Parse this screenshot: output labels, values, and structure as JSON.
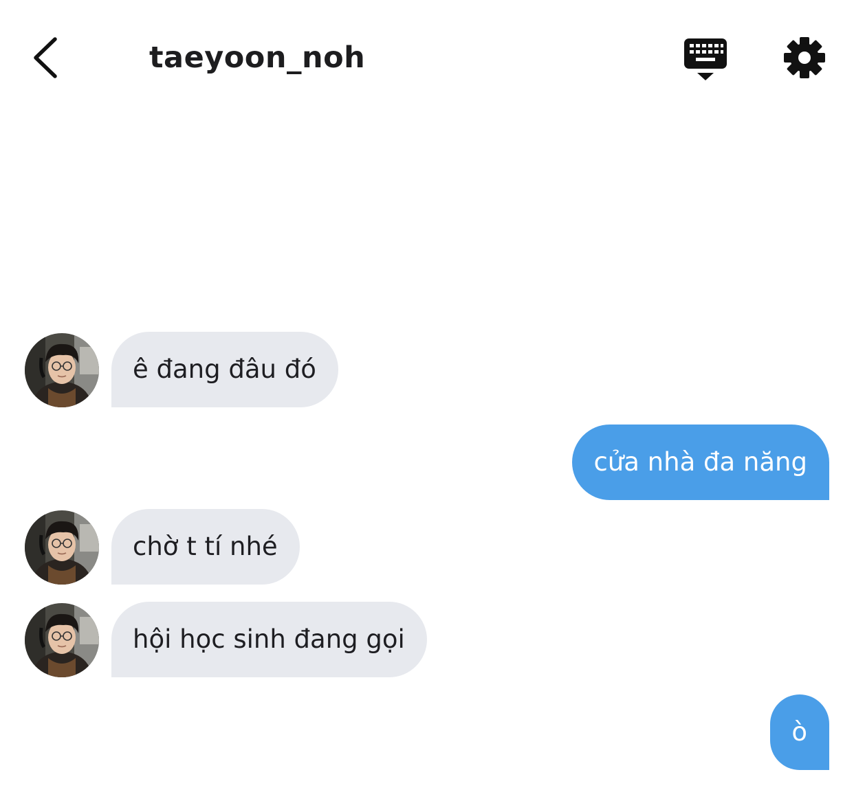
{
  "header": {
    "title": "taeyoon_noh",
    "back_icon": "chevron-left-icon",
    "keyboard_icon": "keyboard-icon",
    "settings_icon": "gear-icon"
  },
  "colors": {
    "incoming_bubble": "#e7e9ee",
    "outgoing_bubble": "#4a9ee8",
    "text_dark": "#1e1e22",
    "text_light": "#ffffff"
  },
  "messages": [
    {
      "direction": "incoming",
      "text": "ê đang đâu đó"
    },
    {
      "direction": "outgoing",
      "text": "cửa nhà đa năng"
    },
    {
      "direction": "incoming",
      "text": "chờ t tí nhé"
    },
    {
      "direction": "incoming",
      "text": "hội học sinh đang gọi"
    },
    {
      "direction": "outgoing",
      "text": "ò"
    }
  ]
}
